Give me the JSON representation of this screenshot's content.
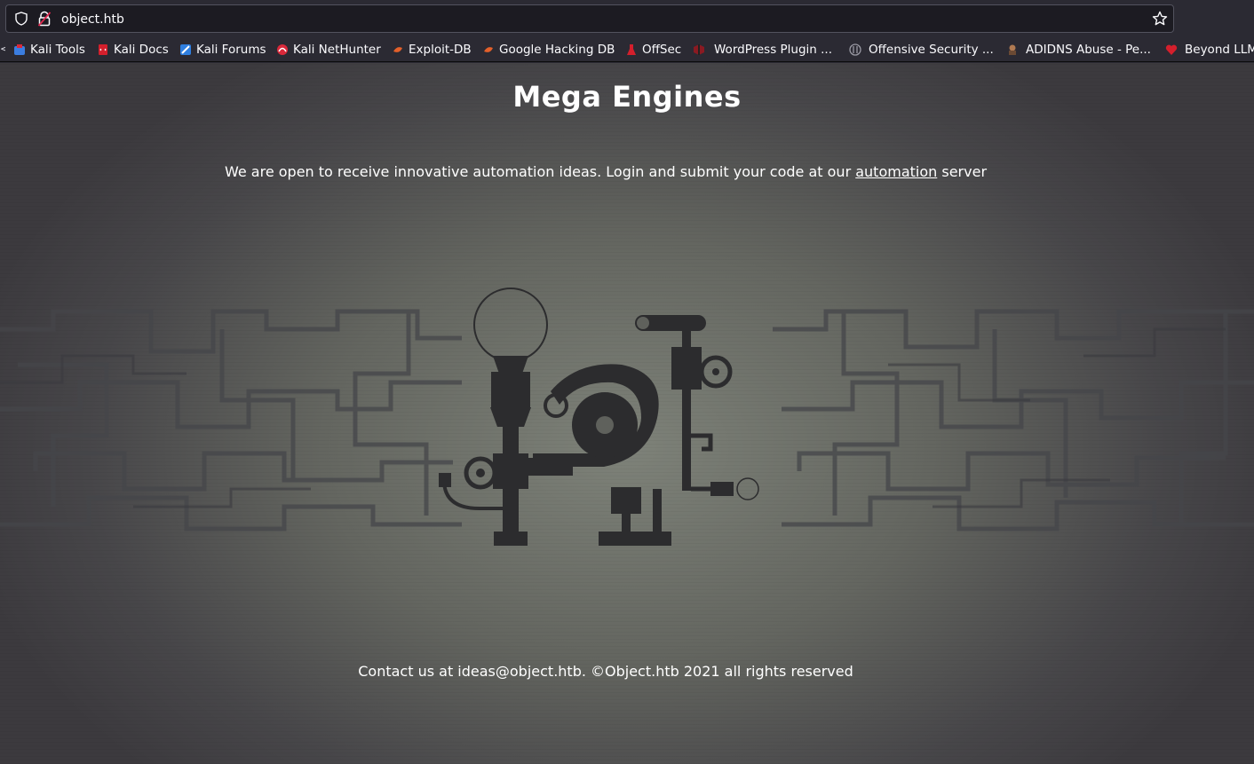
{
  "browser": {
    "url": "object.htb",
    "bookmarks": [
      {
        "label": "Kali Tools",
        "icon": "kali-tools-icon",
        "color": "#3b7de0"
      },
      {
        "label": "Kali Docs",
        "icon": "kali-docs-icon",
        "color": "#d41f2c"
      },
      {
        "label": "Kali Forums",
        "icon": "kali-forums-icon",
        "color": "#2f7fe0"
      },
      {
        "label": "Kali NetHunter",
        "icon": "kali-nethunter-icon",
        "color": "#d9283a"
      },
      {
        "label": "Exploit-DB",
        "icon": "exploit-db-icon",
        "color": "#e4602a"
      },
      {
        "label": "Google Hacking DB",
        "icon": "google-hacking-db-icon",
        "color": "#e4602a"
      },
      {
        "label": "OffSec",
        "icon": "offsec-icon",
        "color": "#d41f2c"
      },
      {
        "label": "WordPress Plugin ...",
        "icon": "wordpress-plugin-icon",
        "color": "#b4202a"
      },
      {
        "label": "Offensive Security ...",
        "icon": "offensive-security-icon",
        "color": "#9a9aa4"
      },
      {
        "label": "ADIDNS Abuse - Pe...",
        "icon": "adidns-abuse-icon",
        "color": "#b07a52"
      },
      {
        "label": "Beyond LLM",
        "icon": "beyond-llm-icon",
        "color": "#d41f2c"
      }
    ]
  },
  "page": {
    "title": "Mega Engines",
    "tagline_prefix": "We are open to receive innovative automation ideas. Login and submit your code at our ",
    "tagline_link": "automation",
    "tagline_suffix": " server",
    "footer": "Contact us at ideas@object.htb. ©Object.htb 2021 all rights reserved"
  },
  "colors": {
    "machine": "#2c2c2e",
    "pipes": "#45464a"
  }
}
